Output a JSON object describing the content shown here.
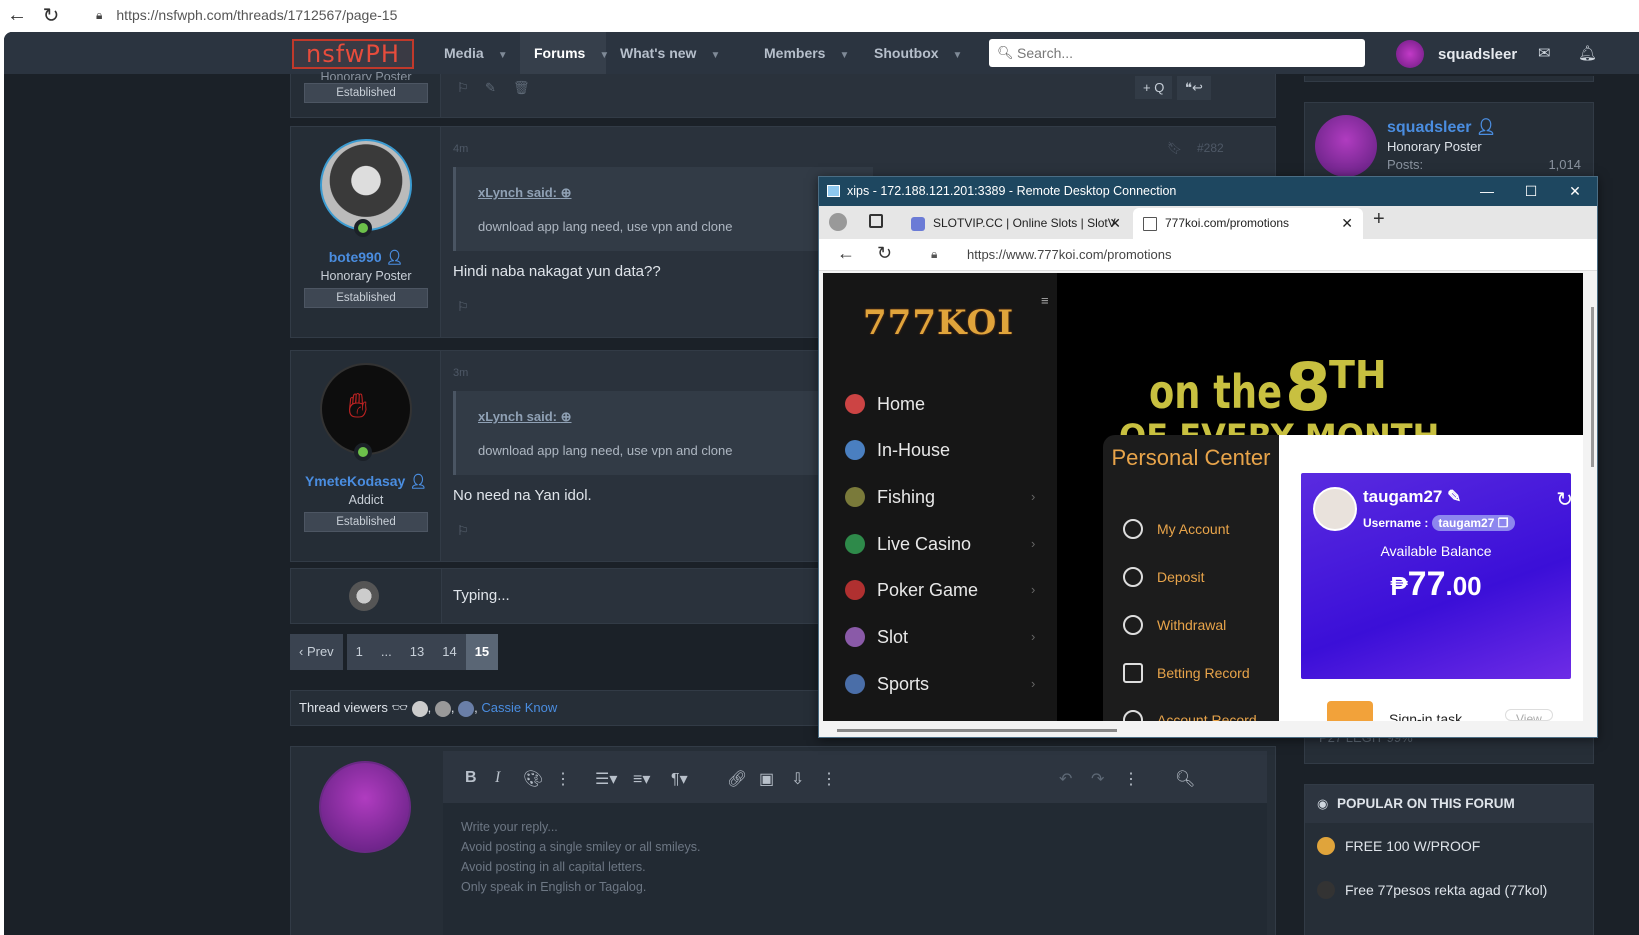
{
  "browser": {
    "url": "https://nsfwph.com/threads/1712567/page-15"
  },
  "nav": {
    "logo": "nsfwPH",
    "items": [
      {
        "label": "Media"
      },
      {
        "label": "Forums"
      },
      {
        "label": "What's new"
      },
      {
        "label": "Members"
      },
      {
        "label": "Shoutbox"
      }
    ],
    "search_placeholder": "Search...",
    "username": "squadsleer"
  },
  "posts": [
    {
      "author": "",
      "title": "Honorary Poster",
      "badge": "Established"
    },
    {
      "author": "bote990",
      "title": "Honorary Poster",
      "badge": "Established",
      "time": "4m",
      "number": "#282",
      "quote_author": "xLynch said:",
      "quote_text": "download app lang need, use vpn and clone",
      "text": "Hindi naba nakagat yun data??"
    },
    {
      "author": "YmeteKodasay",
      "title": "Addict",
      "badge": "Established",
      "time": "3m",
      "quote_author": "xLynch said:",
      "quote_text": "download app lang need, use vpn and clone",
      "text": "No need na Yan idol."
    }
  ],
  "post_actions": {
    "quote": "+ Q"
  },
  "typing": "Typing...",
  "pager": {
    "prev": "‹ Prev",
    "pages": [
      "1",
      "...",
      "13",
      "14",
      "15"
    ],
    "current": "15"
  },
  "viewers": {
    "label": "Thread viewers",
    "sep": ",",
    "link": "Cassie Know"
  },
  "editor": {
    "placeholder_lines": [
      "Write your reply...",
      "Avoid posting a single smiley or all smileys.",
      "Avoid posting in all capital letters.",
      "Only speak in English or Tagalog."
    ]
  },
  "sidebar": {
    "user": {
      "name": "squadsleer",
      "title": "Honorary Poster",
      "posts_label": "Posts:",
      "posts": "1,014"
    },
    "partial_item": "P27 LEGIT 99%",
    "popular_title": "POPULAR ON THIS FORUM",
    "popular_items": [
      "FREE 100 W/PROOF",
      "Free 77pesos rekta agad (77kol)"
    ]
  },
  "remote": {
    "title": "xips - 172.188.121.201:3389 - Remote Desktop Connection",
    "tabs": [
      {
        "label": "SLOTVIP.CC | Online Slots | SlotV"
      },
      {
        "label": "777koi.com/promotions"
      }
    ],
    "url": "https://www.777koi.com/promotions"
  },
  "koi": {
    "logo": "777KOI",
    "nav": [
      "Home",
      "In-House",
      "Fishing",
      "Live Casino",
      "Poker Game",
      "Slot",
      "Sports"
    ],
    "banner_text": "on the",
    "banner_big": "8",
    "banner_sup": "TH",
    "banner_sub": "OF EVERY MONTH",
    "pc_title": "Personal Center",
    "pc_items": [
      "My Account",
      "Deposit",
      "Withdrawal",
      "Betting Record",
      "Account Record"
    ],
    "card": {
      "name": "taugam27",
      "username_label": "Username :",
      "username": "taugam27",
      "balance_label": "Available Balance",
      "currency": "₱",
      "balance_int": "77",
      "balance_dec": ".00"
    },
    "signin": "Sign-in task",
    "view": "View"
  },
  "colors": {
    "site_bg": "#1b2128",
    "nav_bg": "#2b3440",
    "link": "#4a8de0",
    "koi_orange": "#e8a44a",
    "card_purple": "#4b1ddc"
  }
}
